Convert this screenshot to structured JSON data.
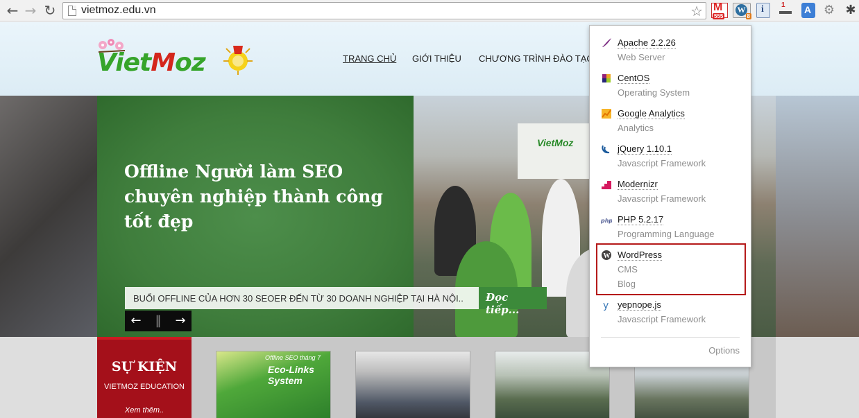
{
  "browser": {
    "url": "vietmoz.edu.vn",
    "back_glyph": "←",
    "forward_glyph": "→",
    "reload_glyph": "↻",
    "star_glyph": "☆",
    "gmail_badge": "555",
    "wp_badge": "8",
    "info_glyph": "i",
    "one_glyph": "1",
    "translate_glyph": "A",
    "gear_glyph": "⚙",
    "wrench_glyph": "✱"
  },
  "site": {
    "logo": {
      "part1": "Viet",
      "part2": "M",
      "part3": "oz"
    },
    "menu": [
      "TRANG CHỦ",
      "GIỚI THIỆU",
      "CHƯƠNG TRÌNH ĐÀO TẠO"
    ],
    "slide": {
      "title": "Offline Người làm SEO chuyên nghiệp thành công tốt đẹp",
      "caption": "BUỔI OFFLINE CỦA HƠN 30 SEOER ĐẾN TỪ 30 DOANH NGHIỆP TẠI HÀ NỘI..",
      "read_more": "Đọc tiếp...",
      "prev_glyph": "←",
      "pause_glyph": "‖",
      "next_glyph": "→",
      "photo_brand": "VietMoz"
    },
    "events": {
      "title": "SỰ KIỆN",
      "subtitle": "VIETMOZ EDUCATION",
      "more": "Xem thêm..",
      "poster_kicker": "Offline SEO tháng 7",
      "poster_title": "Eco-Links System"
    }
  },
  "popup": {
    "items": [
      {
        "name": "Apache 2.2.26",
        "categories": [
          "Web Server"
        ],
        "icon": "feather-icon",
        "color": "#7b2c82"
      },
      {
        "name": "CentOS",
        "categories": [
          "Operating System"
        ],
        "icon": "pinwheel-icon",
        "color": "#932279"
      },
      {
        "name": "Google Analytics",
        "categories": [
          "Analytics"
        ],
        "icon": "chart-icon",
        "color": "#e37400"
      },
      {
        "name": "jQuery 1.10.1",
        "categories": [
          "Javascript Framework"
        ],
        "icon": "swirl-icon",
        "color": "#1a5a9c"
      },
      {
        "name": "Modernizr",
        "categories": [
          "Javascript Framework"
        ],
        "icon": "stairs-icon",
        "color": "#d6195f"
      },
      {
        "name": "PHP 5.2.17",
        "categories": [
          "Programming Language"
        ],
        "icon": "php-icon",
        "color": "#4f5b93"
      },
      {
        "name": "WordPress",
        "categories": [
          "CMS",
          "Blog"
        ],
        "icon": "wordpress-icon",
        "color": "#21759b"
      },
      {
        "name": "yepnope.js",
        "categories": [
          "Javascript Framework"
        ],
        "icon": "y-icon",
        "color": "#3b7ab8"
      }
    ],
    "options_label": "Options"
  }
}
